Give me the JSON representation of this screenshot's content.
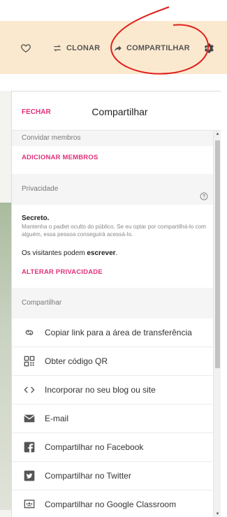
{
  "toolbar": {
    "heart_icon": "heart-outline-icon",
    "clone_label": "CLONAR",
    "share_label": "COMPARTILHAR",
    "gear_icon": "gear-icon"
  },
  "panel": {
    "close_label": "FECHAR",
    "title": "Compartilhar"
  },
  "invite": {
    "heading": "Convidar membros",
    "action": "ADICIONAR MEMBROS"
  },
  "privacy": {
    "heading": "Privacidade",
    "level": "Secreto.",
    "description": "Mantenha o padlet oculto do público. Se eu optar por compartilhá-lo com alguém, essa pessoa conseguirá acessá-lo.",
    "visitors_prefix": "Os visitantes podem ",
    "visitors_permission": "escrever",
    "visitors_suffix": ".",
    "action": "ALTERAR PRIVACIDADE"
  },
  "share": {
    "heading": "Compartilhar",
    "items": [
      {
        "icon": "link-icon",
        "label": "Copiar link para a área de transferência"
      },
      {
        "icon": "qr-code-icon",
        "label": "Obter código QR"
      },
      {
        "icon": "embed-code-icon",
        "label": "Incorporar no seu blog ou site"
      },
      {
        "icon": "email-icon",
        "label": "E-mail"
      },
      {
        "icon": "facebook-icon",
        "label": "Compartilhar no Facebook"
      },
      {
        "icon": "twitter-icon",
        "label": "Compartilhar no Twitter"
      },
      {
        "icon": "google-classroom-icon",
        "label": "Compartilhar no Google Classroom"
      }
    ]
  },
  "colors": {
    "accent": "#e0307a",
    "toolbar_bg": "#fbe9cf",
    "annotation_red": "#e0201c"
  }
}
